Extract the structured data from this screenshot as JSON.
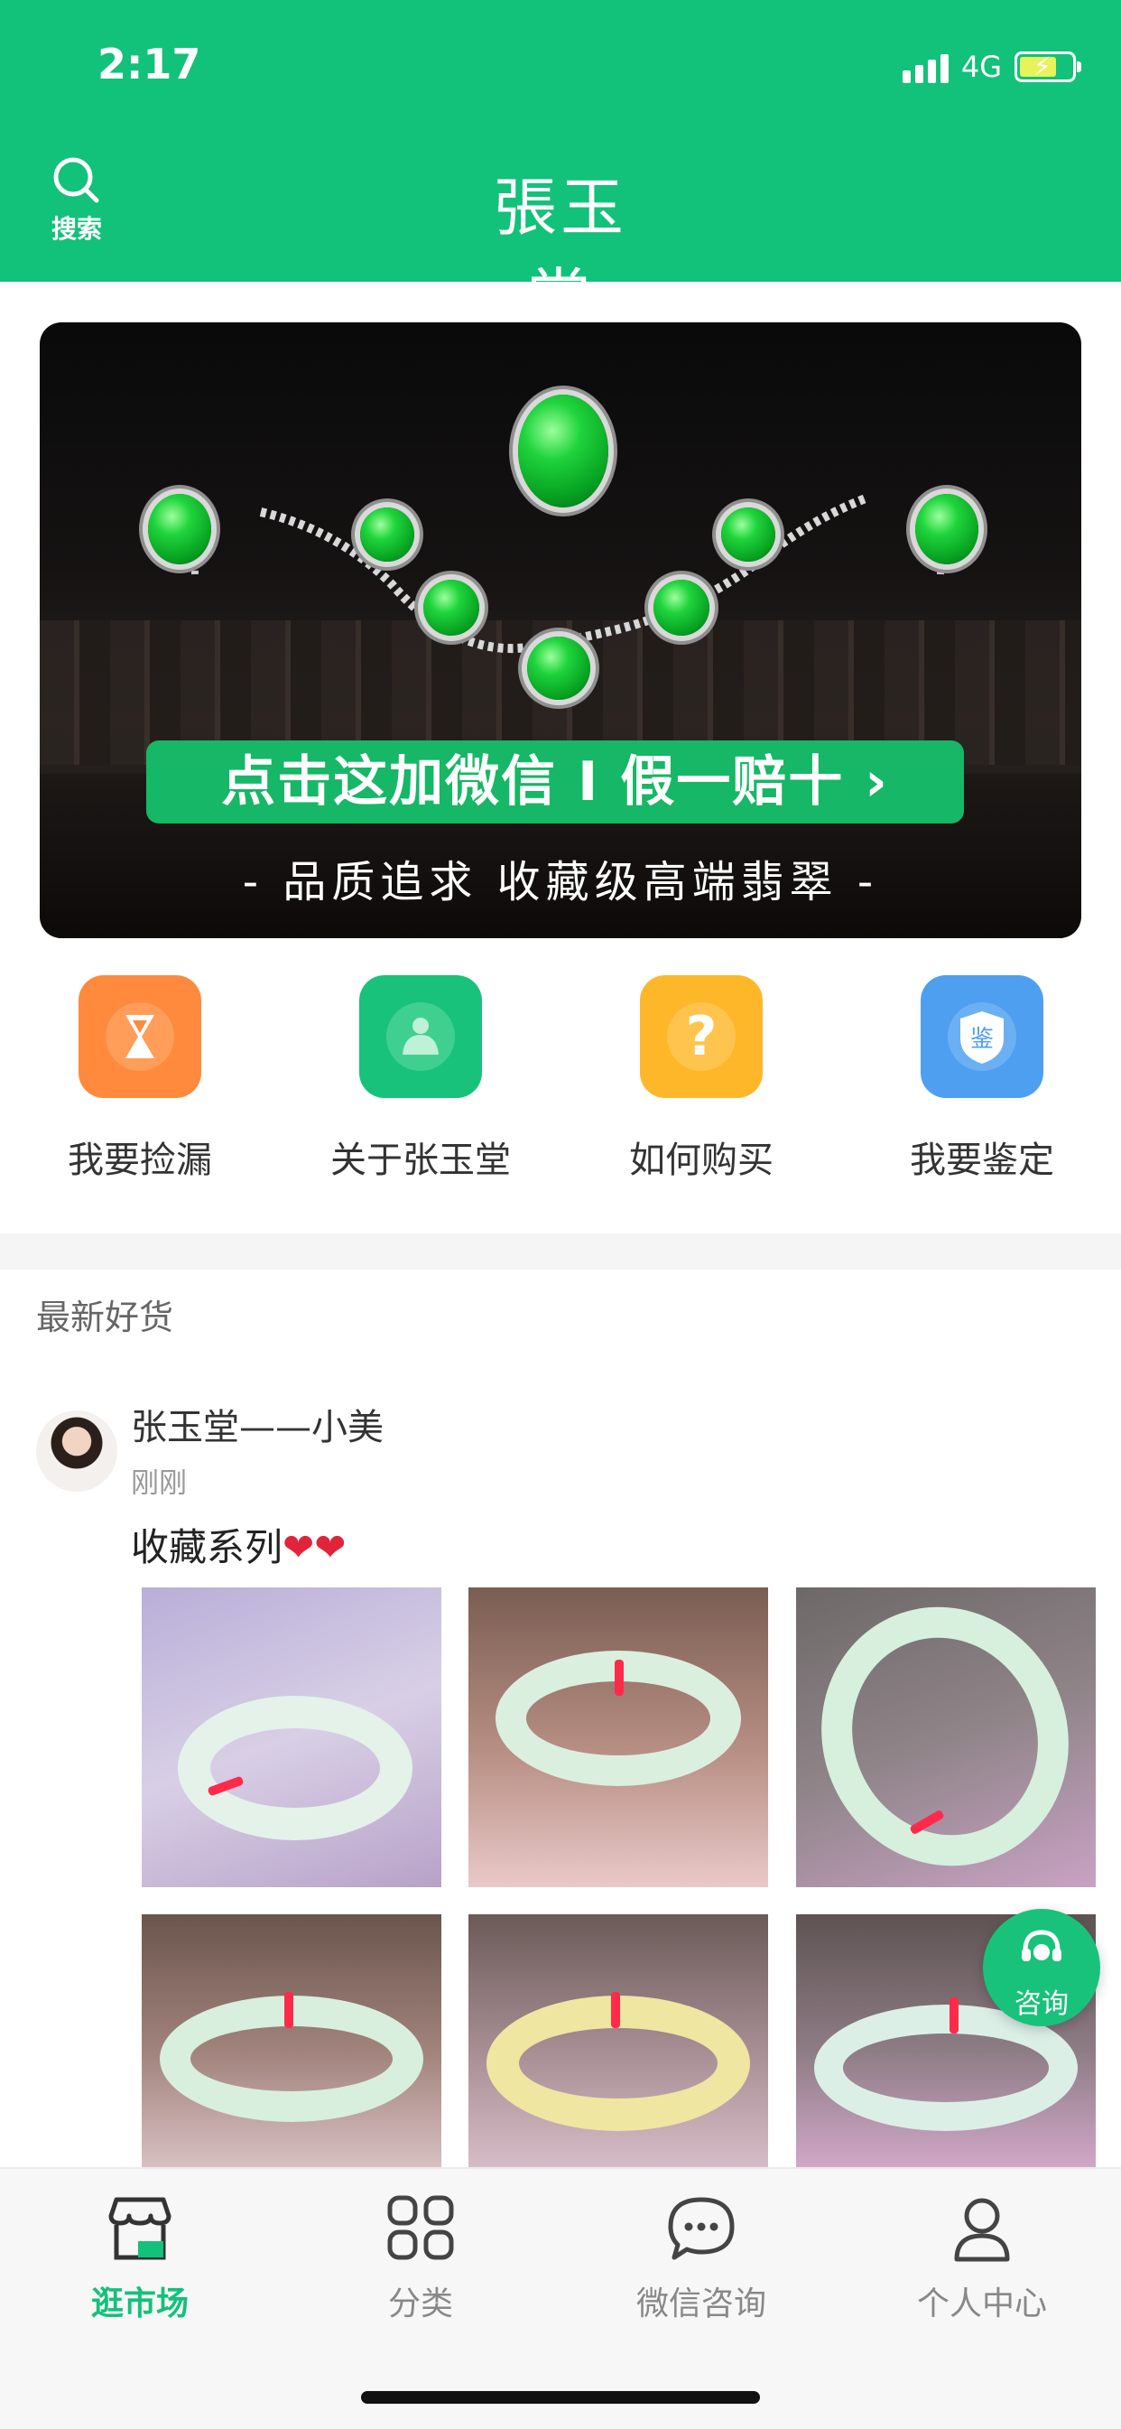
{
  "status_bar": {
    "time": "2:17",
    "network": "4G"
  },
  "header": {
    "search_label": "搜索",
    "logo_text": "張玉堂"
  },
  "banner": {
    "cta": "点击这加微信 I 假一赔十 ›",
    "subtitle": "-  品质追求  收藏级高端翡翠  -"
  },
  "quick_entries": [
    {
      "label": "我要捡漏",
      "icon": "hourglass-icon",
      "color": "#ff8a3d"
    },
    {
      "label": "关于张玉堂",
      "icon": "buddha-icon",
      "color": "#19c27a"
    },
    {
      "label": "如何购买",
      "icon": "question-icon",
      "color": "#ffb72a"
    },
    {
      "label": "我要鉴定",
      "icon": "shield-icon",
      "color": "#4f9ff0",
      "badge": "鉴"
    }
  ],
  "feed": {
    "section_title": "最新好货",
    "post": {
      "author": "张玉堂——小美",
      "time": "刚刚",
      "text": "收藏系列",
      "hearts": "❤❤"
    }
  },
  "consult_button": {
    "label": "咨询"
  },
  "tabbar": {
    "items": [
      {
        "label": "逛市场",
        "icon": "store-icon",
        "active": true
      },
      {
        "label": "分类",
        "icon": "grid-icon",
        "active": false
      },
      {
        "label": "微信咨询",
        "icon": "chat-bubble-icon",
        "active": false
      },
      {
        "label": "个人中心",
        "icon": "user-icon",
        "active": false
      }
    ]
  },
  "colors": {
    "brand_green": "#12c17a",
    "tab_inactive": "#888888"
  }
}
